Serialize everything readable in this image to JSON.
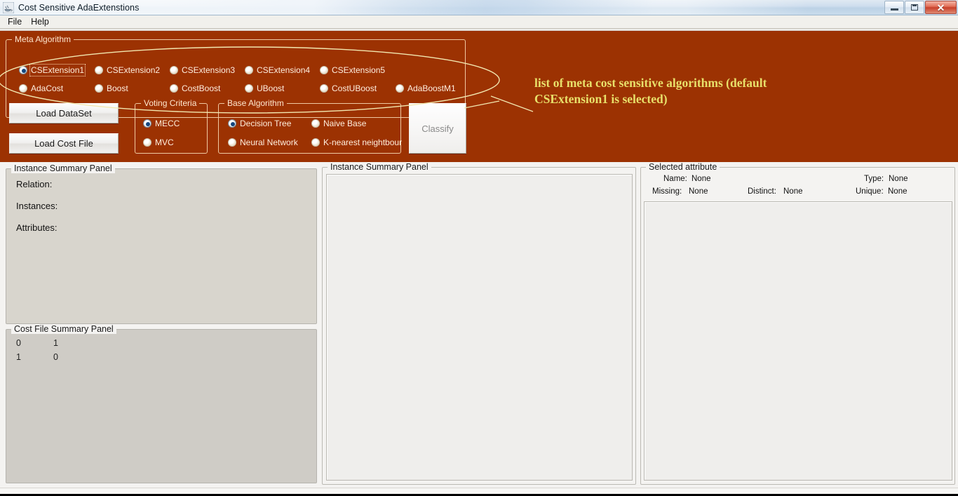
{
  "window": {
    "title": "Cost Sensitive AdaExtenstions",
    "icon": "java-coffee-cup-icon",
    "buttons": {
      "minimize": "minimize-icon",
      "maximize": "maximize-icon",
      "close": "✕"
    }
  },
  "menubar": {
    "items": [
      {
        "label": "File"
      },
      {
        "label": "Help"
      }
    ]
  },
  "meta_algorithm": {
    "legend": "Meta Algorithm",
    "options": [
      {
        "label": "CSExtension1",
        "selected": true
      },
      {
        "label": "CSExtension2",
        "selected": false
      },
      {
        "label": "CSExtension3",
        "selected": false
      },
      {
        "label": "CSExtension4",
        "selected": false
      },
      {
        "label": "CSExtension5",
        "selected": false
      },
      {
        "label": "AdaCost",
        "selected": false
      },
      {
        "label": "Boost",
        "selected": false
      },
      {
        "label": "CostBoost",
        "selected": false
      },
      {
        "label": "UBoost",
        "selected": false
      },
      {
        "label": "CostUBoost",
        "selected": false
      },
      {
        "label": "AdaBoostM1",
        "selected": false
      }
    ]
  },
  "voting_criteria": {
    "legend": "Voting Criteria",
    "options": [
      {
        "label": "MECC",
        "selected": true
      },
      {
        "label": "MVC",
        "selected": false
      }
    ]
  },
  "base_algorithm": {
    "legend": "Base Algorithm",
    "options": [
      {
        "label": "Decision Tree",
        "selected": true
      },
      {
        "label": "Naive Base",
        "selected": false
      },
      {
        "label": "Neural Network",
        "selected": false
      },
      {
        "label": "K-nearest neightbour",
        "selected": false
      }
    ]
  },
  "actions": {
    "load_dataset": "Load DataSet",
    "load_cost_file": "Load Cost File",
    "classify": "Classify"
  },
  "annotation": {
    "text": "list of meta cost sensitive algorithms (default CSExtension1 is selected)",
    "color": "#e8e06a",
    "shape": "ellipse-callout"
  },
  "instance_summary_left": {
    "legend": "Instance Summary Panel",
    "fields": [
      {
        "label": "Relation:",
        "value": ""
      },
      {
        "label": "Instances:",
        "value": ""
      },
      {
        "label": "Attributes:",
        "value": ""
      }
    ]
  },
  "cost_file_summary": {
    "legend": "Cost File Summary Panel",
    "matrix": [
      [
        "0",
        "1"
      ],
      [
        "1",
        "0"
      ]
    ]
  },
  "instance_summary_center": {
    "legend": "Instance Summary Panel",
    "content": ""
  },
  "selected_attribute": {
    "legend": "Selected attribute",
    "fields": [
      {
        "label": "Name:",
        "value": "None"
      },
      {
        "label": "Type:",
        "value": "None"
      },
      {
        "label": "Missing:",
        "value": "None"
      },
      {
        "label": "Distinct:",
        "value": "None"
      },
      {
        "label": "Unique:",
        "value": "None"
      }
    ]
  },
  "colors": {
    "control_background": "#9c3202",
    "group_border": "#f0c9a2",
    "panel_background": "#ececea",
    "annotation": "#e8e06a"
  }
}
